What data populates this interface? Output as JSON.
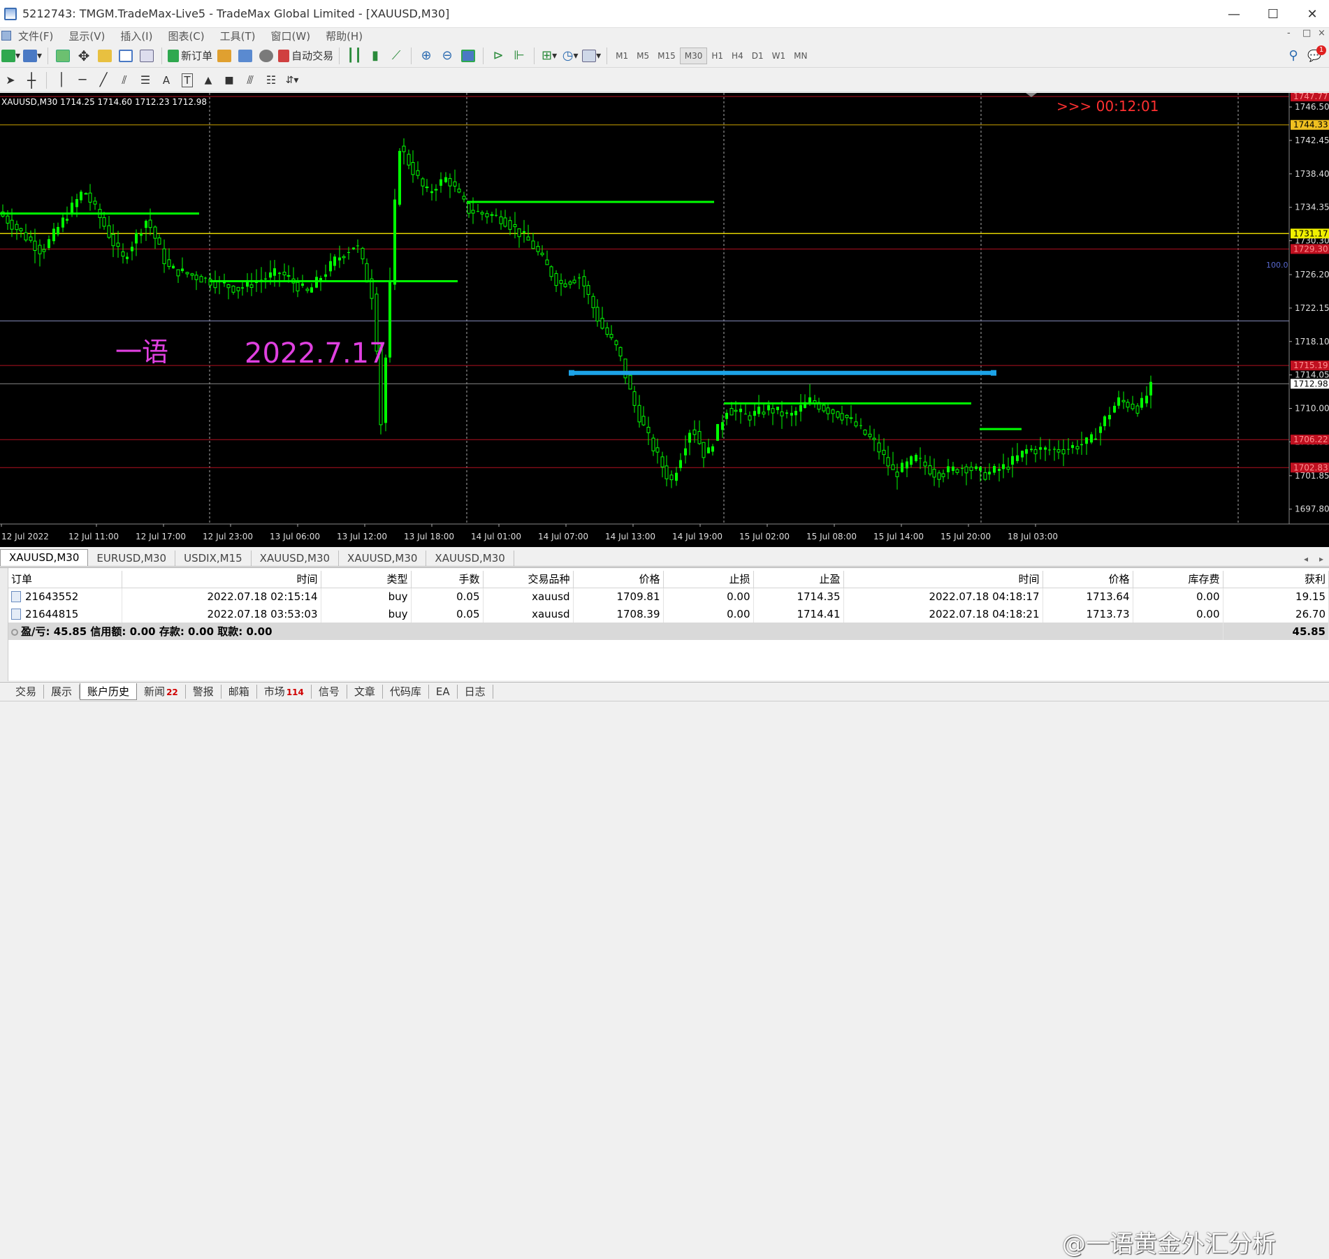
{
  "window": {
    "title": "5212743: TMGM.TradeMax-Live5 - TradeMax Global Limited - [XAUUSD,M30]",
    "controls": [
      "—",
      "☐",
      "✕"
    ]
  },
  "menu": {
    "items": [
      "文件(F)",
      "显示(V)",
      "插入(I)",
      "图表(C)",
      "工具(T)",
      "窗口(W)",
      "帮助(H)"
    ],
    "mdi_controls": [
      "-",
      "□",
      "×"
    ]
  },
  "toolbar": {
    "new_order_label": "新订单",
    "auto_trade_label": "自动交易",
    "timeframes": [
      "M1",
      "M5",
      "M15",
      "M30",
      "H1",
      "H4",
      "D1",
      "W1",
      "MN"
    ],
    "active_timeframe": "M30",
    "notification_count": "1"
  },
  "chart": {
    "header": "XAUUSD,M30  1714.25 1714.60 1712.23 1712.98",
    "timer": ">>> 00:12:01",
    "annotation_name": "一语",
    "annotation_date": "2022.7.17",
    "fib_label": "100.0",
    "colors": {
      "candle": "#00ff00",
      "support": "#00ff00",
      "blue_line": "#1ca3e8",
      "red_line": "#b01020",
      "yellow_line": "#e0d000",
      "gold_line": "#c8a000",
      "price_line": "#8890c0",
      "annotation": "#e040e0",
      "timer": "#ff3030"
    },
    "price_axis": {
      "ticks": [
        "1746.50",
        "1742.45",
        "1738.40",
        "1734.35",
        "1730.30",
        "1726.20",
        "1722.15",
        "1718.10",
        "1714.05",
        "1710.00",
        "1705.95",
        "1701.85",
        "1697.80"
      ],
      "level_labels": [
        {
          "text": "1747.77",
          "color": "red"
        },
        {
          "text": "1744.33",
          "color": "gold"
        },
        {
          "text": "1731.17",
          "color": "yellow"
        },
        {
          "text": "1729.30",
          "color": "red"
        },
        {
          "text": "1715.19",
          "color": "red"
        },
        {
          "text": "1712.98",
          "color": "white"
        },
        {
          "text": "1706.22",
          "color": "red"
        },
        {
          "text": "1702.83",
          "color": "red"
        }
      ]
    },
    "time_axis": [
      "12 Jul 2022",
      "12 Jul 11:00",
      "12 Jul 17:00",
      "12 Jul 23:00",
      "13 Jul 06:00",
      "13 Jul 12:00",
      "13 Jul 18:00",
      "14 Jul 01:00",
      "14 Jul 07:00",
      "14 Jul 13:00",
      "14 Jul 19:00",
      "15 Jul 02:00",
      "15 Jul 08:00",
      "15 Jul 14:00",
      "15 Jul 20:00",
      "18 Jul 03:00"
    ]
  },
  "chart_tabs": [
    "XAUUSD,M30",
    "EURUSD,M30",
    "USDIX,M15",
    "XAUUSD,M30",
    "XAUUSD,M30",
    "XAUUSD,M30"
  ],
  "orders": {
    "columns": [
      "订单",
      "时间",
      "类型",
      "手数",
      "交易品种",
      "价格",
      "止损",
      "止盈",
      "时间",
      "价格",
      "库存费",
      "获利"
    ],
    "rows": [
      [
        "21643552",
        "2022.07.18 02:15:14",
        "buy",
        "0.05",
        "xauusd",
        "1709.81",
        "0.00",
        "1714.35",
        "2022.07.18 04:18:17",
        "1713.64",
        "0.00",
        "19.15"
      ],
      [
        "21644815",
        "2022.07.18 03:53:03",
        "buy",
        "0.05",
        "xauusd",
        "1708.39",
        "0.00",
        "1714.41",
        "2022.07.18 04:18:21",
        "1713.73",
        "0.00",
        "26.70"
      ]
    ],
    "summary": "盈/亏: 45.85  信用额: 0.00  存款: 0.00  取款: 0.00",
    "summary_total": "45.85"
  },
  "bottom_tabs": [
    {
      "label": "交易",
      "badge": ""
    },
    {
      "label": "展示",
      "badge": ""
    },
    {
      "label": "账户历史",
      "badge": ""
    },
    {
      "label": "新闻",
      "badge": "22"
    },
    {
      "label": "警报",
      "badge": ""
    },
    {
      "label": "邮箱",
      "badge": ""
    },
    {
      "label": "市场",
      "badge": "114"
    },
    {
      "label": "信号",
      "badge": ""
    },
    {
      "label": "文章",
      "badge": ""
    },
    {
      "label": "代码库",
      "badge": ""
    },
    {
      "label": "EA",
      "badge": ""
    },
    {
      "label": "日志",
      "badge": ""
    }
  ],
  "active_bottom_tab": "账户历史",
  "watermark": "@一语黄金外汇分析"
}
